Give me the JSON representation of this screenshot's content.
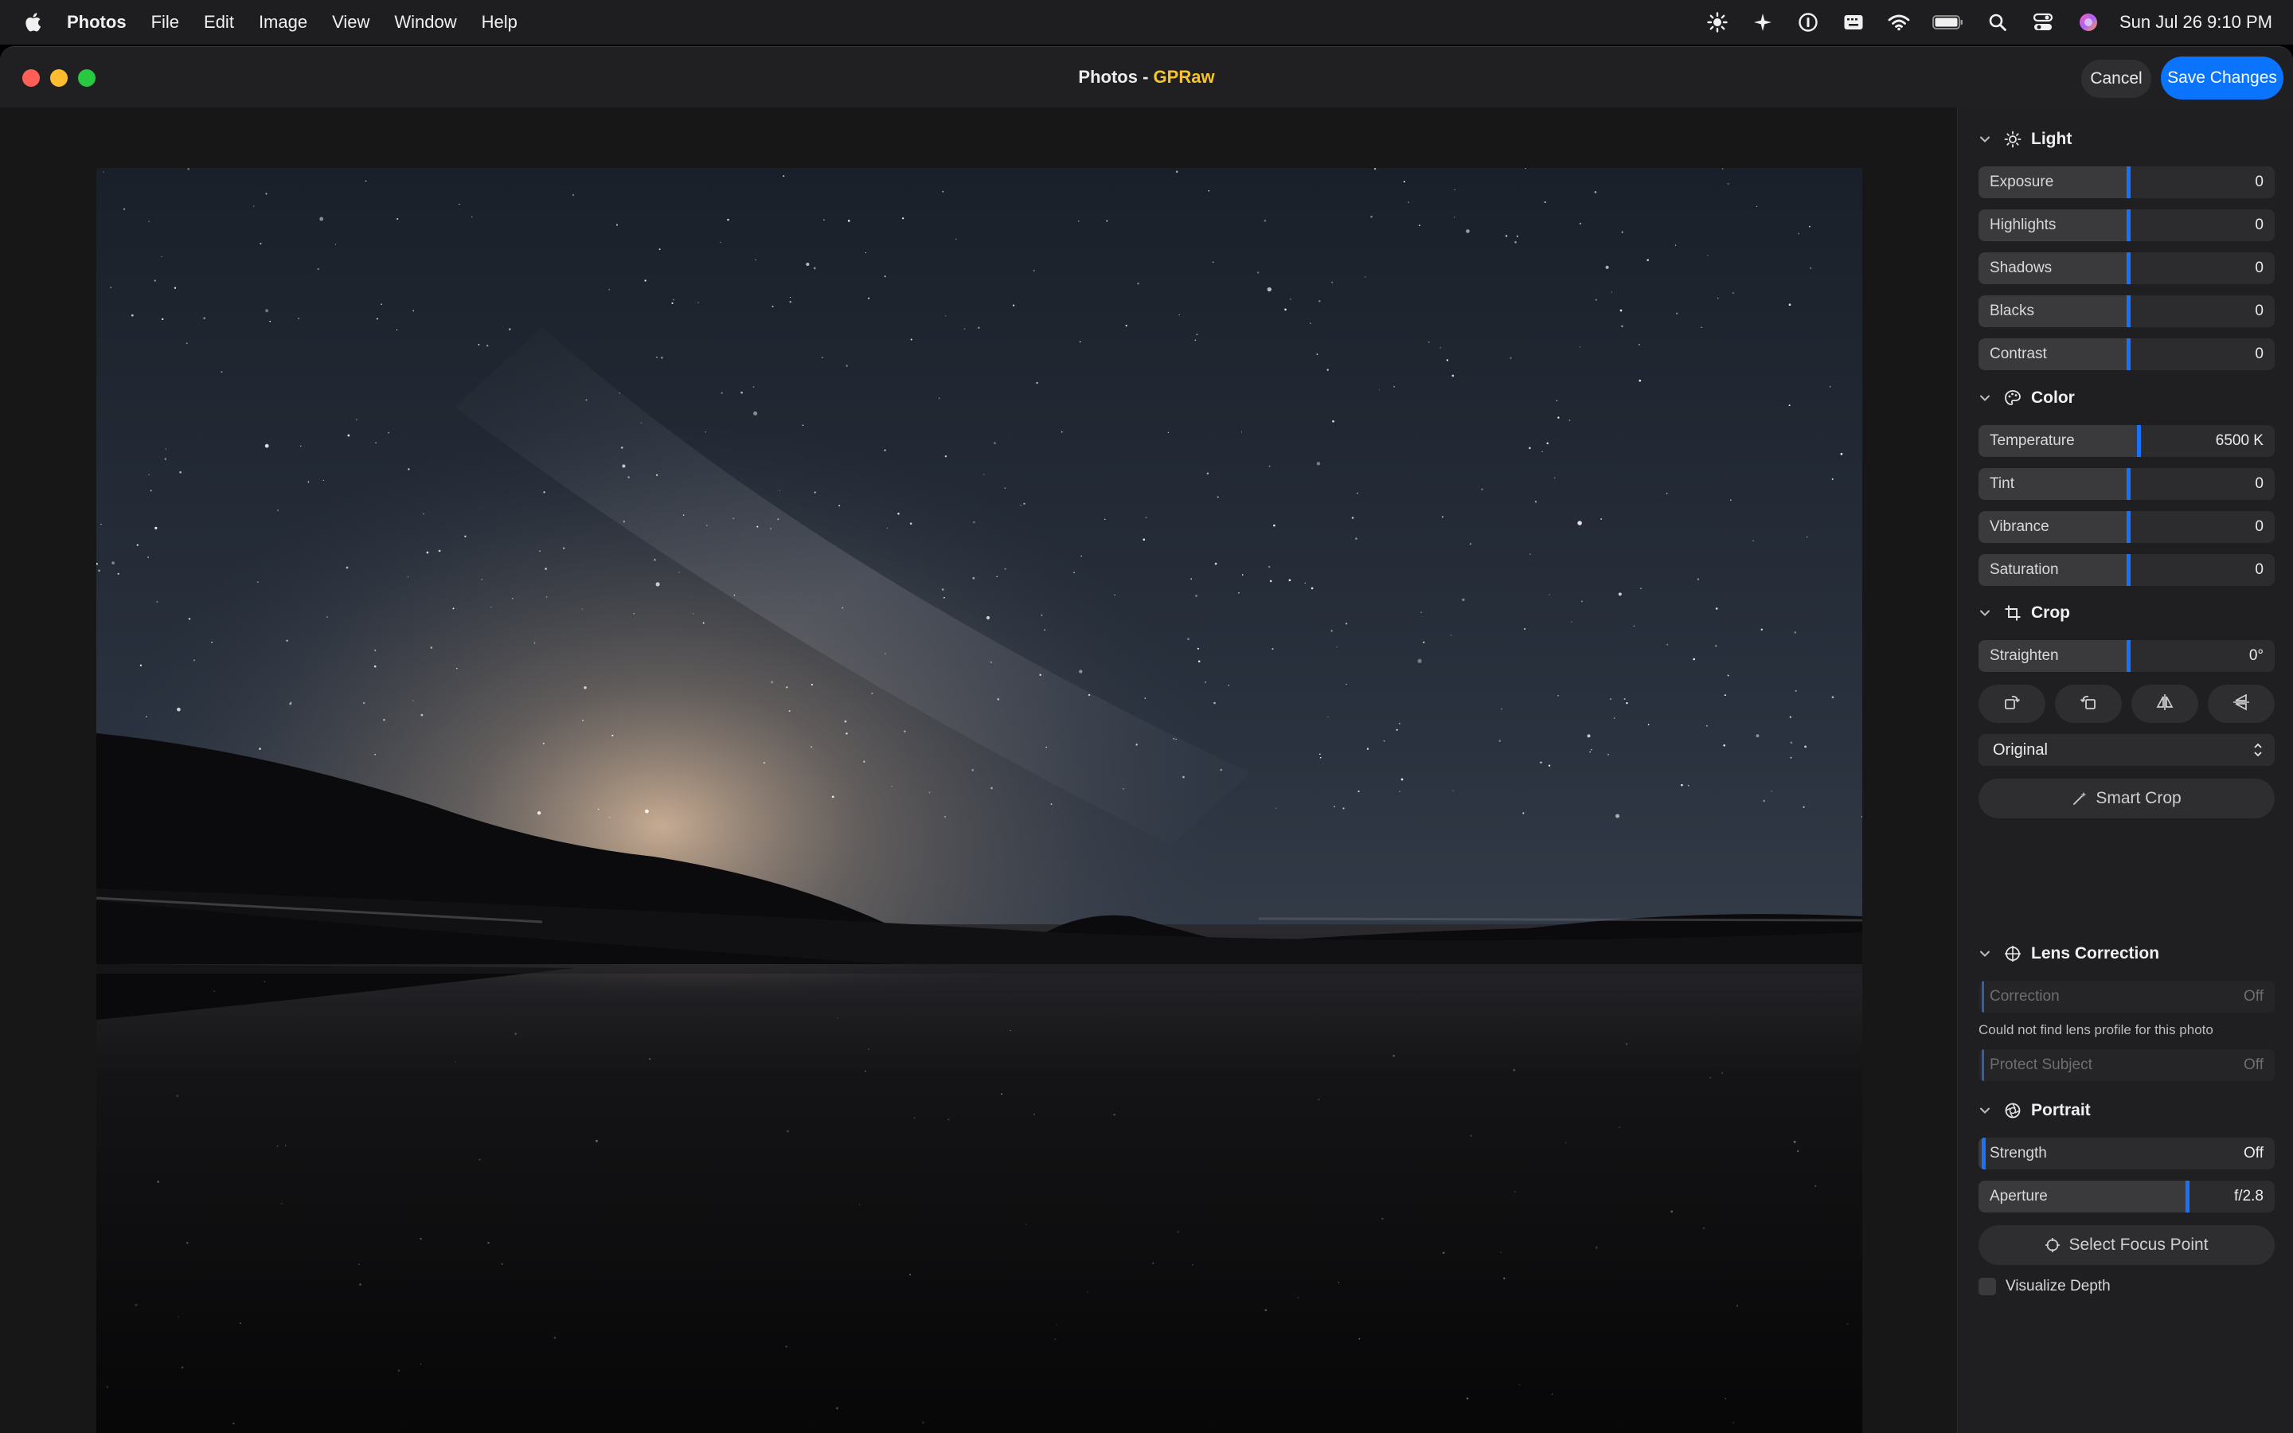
{
  "menubar": {
    "app_name": "Photos",
    "items": [
      "File",
      "Edit",
      "Image",
      "View",
      "Window",
      "Help"
    ],
    "clock": "Sun Jul 26  9:10 PM",
    "status_icons": [
      "brightness-icon",
      "sparkle-icon",
      "password-icon",
      "keyboard-icon",
      "wifi-icon",
      "battery-icon",
      "spotlight-icon",
      "control-center-icon",
      "siri-icon"
    ]
  },
  "window": {
    "title_app": "Photos",
    "title_sep": " - ",
    "title_file": "GPRaw",
    "cancel_label": "Cancel",
    "save_label": "Save Changes"
  },
  "sidebar": {
    "light": {
      "label": "Light",
      "sliders": [
        {
          "label": "Exposure",
          "value": "0",
          "level": 0.5
        },
        {
          "label": "Highlights",
          "value": "0",
          "level": 0.5
        },
        {
          "label": "Shadows",
          "value": "0",
          "level": 0.5
        },
        {
          "label": "Blacks",
          "value": "0",
          "level": 0.5
        },
        {
          "label": "Contrast",
          "value": "0",
          "level": 0.5
        }
      ]
    },
    "color": {
      "label": "Color",
      "sliders": [
        {
          "label": "Temperature",
          "value": "6500 K",
          "level": 0.535
        },
        {
          "label": "Tint",
          "value": "0",
          "level": 0.5
        },
        {
          "label": "Vibrance",
          "value": "0",
          "level": 0.5
        },
        {
          "label": "Saturation",
          "value": "0",
          "level": 0.5
        }
      ]
    },
    "crop": {
      "label": "Crop",
      "straighten": {
        "label": "Straighten",
        "value": "0°",
        "level": 0.5
      },
      "tools": [
        "rotate-icon",
        "flip-rotate-icon",
        "flip-horizontal-icon",
        "flip-vertical-icon"
      ],
      "aspect_value": "Original",
      "smart_crop_label": "Smart Crop"
    },
    "lens": {
      "label": "Lens Correction",
      "correction": {
        "label": "Correction",
        "value": "Off"
      },
      "note": "Could not find lens profile for this photo",
      "protect": {
        "label": "Protect Subject",
        "value": "Off"
      }
    },
    "portrait": {
      "label": "Portrait",
      "strength": {
        "label": "Strength",
        "value": "Off",
        "level": 0.0
      },
      "aperture": {
        "label": "Aperture",
        "value": "f/2.8",
        "level": 0.7
      },
      "focus_label": "Select Focus Point",
      "depth_label": "Visualize Depth"
    }
  },
  "colors": {
    "accent": "#0a74ff",
    "title_file": "#f5c52a",
    "slider_knob": "#1672ff"
  }
}
